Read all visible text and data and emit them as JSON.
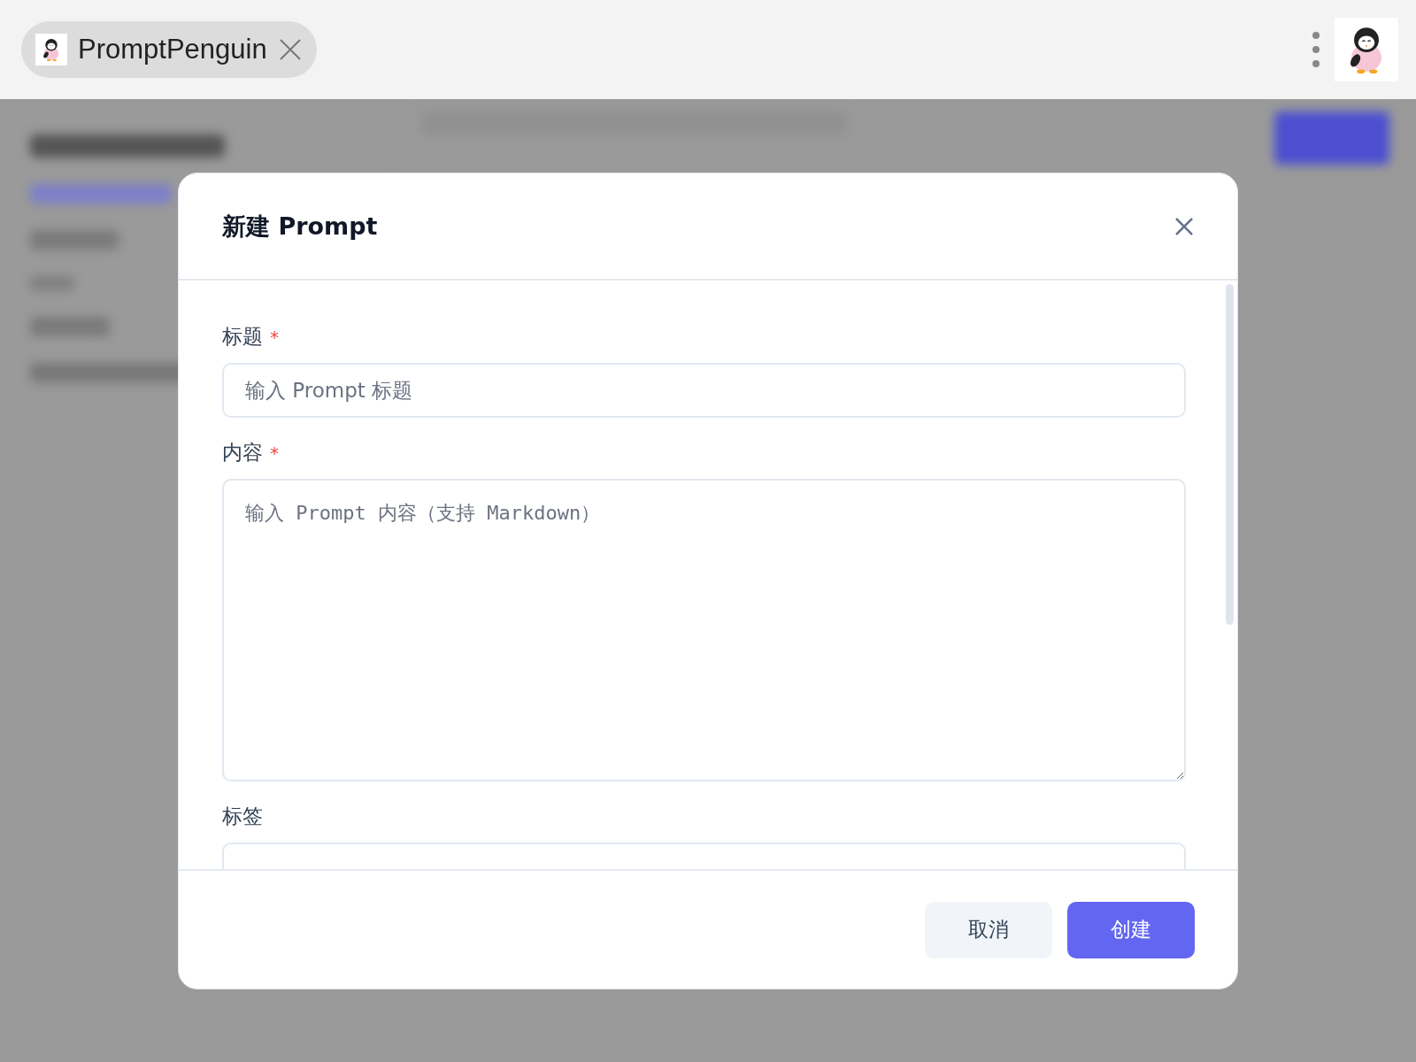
{
  "tab": {
    "title": "PromptPenguin"
  },
  "dialog": {
    "title": "新建 Prompt",
    "fields": [
      {
        "kind": "input",
        "label": "标题",
        "required_mark": "*",
        "placeholder": "输入 Prompt 标题"
      },
      {
        "kind": "textarea",
        "label": "内容",
        "required_mark": "*",
        "placeholder": "输入 Prompt 内容（支持 Markdown）"
      },
      {
        "kind": "input",
        "label": "标签"
      }
    ],
    "buttons": [
      {
        "kind": "secondary",
        "label": "取消"
      },
      {
        "kind": "primary",
        "label": "创建"
      }
    ]
  }
}
